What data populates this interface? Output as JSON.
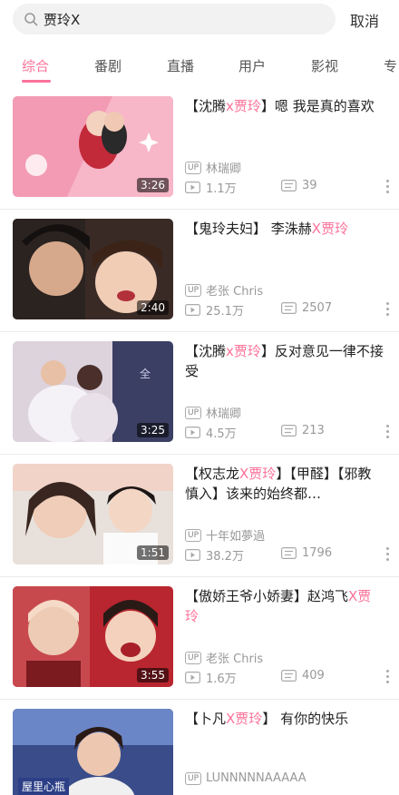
{
  "search": {
    "query": "贾玲X",
    "cancel_label": "取消"
  },
  "tabs": [
    "综合",
    "番剧",
    "直播",
    "用户",
    "影视",
    "专"
  ],
  "active_tab": 0,
  "accent_color": "#fb7299",
  "videos": [
    {
      "title_parts": [
        {
          "t": "【沈腾"
        },
        {
          "t": "x",
          "h": 1
        },
        {
          "t": "贾玲",
          "h": 1
        },
        {
          "t": "】嗯 我是真的喜欢"
        }
      ],
      "uploader": "林瑞卿",
      "plays": "1.1万",
      "danmaku": "39",
      "duration": "3:26"
    },
    {
      "title_parts": [
        {
          "t": "【鬼玲夫妇】 李洙赫"
        },
        {
          "t": "X",
          "h": 1
        },
        {
          "t": "贾玲",
          "h": 1
        }
      ],
      "uploader": "老张 Chris",
      "plays": "25.1万",
      "danmaku": "2507",
      "duration": "2:40"
    },
    {
      "title_parts": [
        {
          "t": "【沈腾"
        },
        {
          "t": "x",
          "h": 1
        },
        {
          "t": "贾玲",
          "h": 1
        },
        {
          "t": "】反对意见一律不接受"
        }
      ],
      "uploader": "林瑞卿",
      "plays": "4.5万",
      "danmaku": "213",
      "duration": "3:25"
    },
    {
      "title_parts": [
        {
          "t": "【权志龙"
        },
        {
          "t": "X",
          "h": 1
        },
        {
          "t": "贾玲",
          "h": 1
        },
        {
          "t": "】【甲醛】【邪教慎入】该来的始终都…"
        }
      ],
      "uploader": "十年如夢過",
      "plays": "38.2万",
      "danmaku": "1796",
      "duration": "1:51"
    },
    {
      "title_parts": [
        {
          "t": "【傲娇王爷小娇妻】赵鸿飞"
        },
        {
          "t": "X",
          "h": 1
        },
        {
          "t": "贾玲",
          "h": 1
        }
      ],
      "uploader": "老张 Chris",
      "plays": "1.6万",
      "danmaku": "409",
      "duration": "3:55"
    },
    {
      "title_parts": [
        {
          "t": "【卜凡"
        },
        {
          "t": "X",
          "h": 1
        },
        {
          "t": "贾玲",
          "h": 1
        },
        {
          "t": "】 有你的快乐"
        }
      ],
      "uploader": "LUNNNNNAAAAA",
      "plays": "",
      "danmaku": "",
      "duration": "",
      "thumb_caption": "屋里心瓶"
    }
  ]
}
